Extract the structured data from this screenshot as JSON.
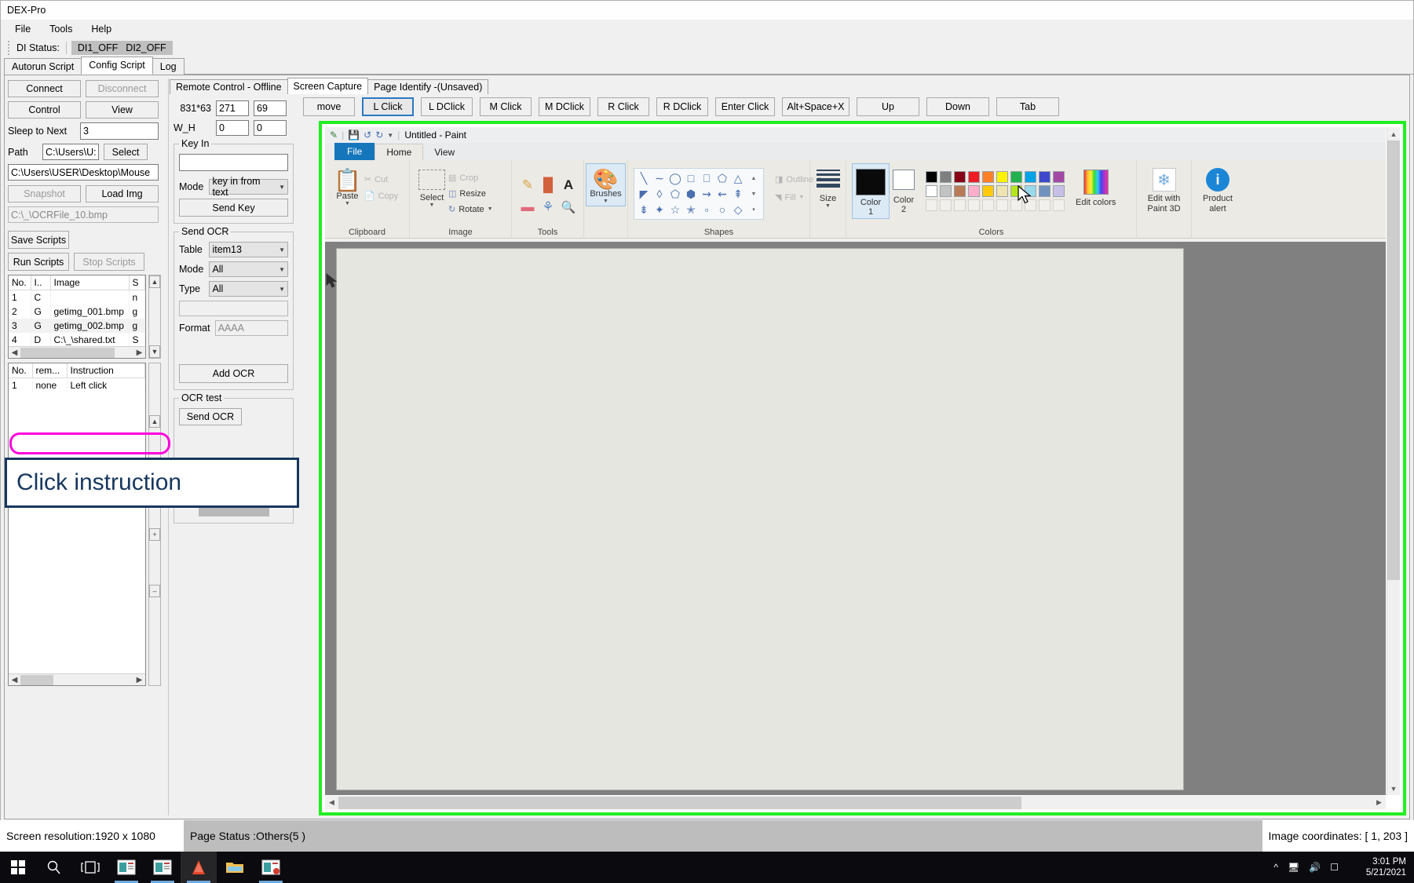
{
  "window": {
    "title": "DEX-Pro"
  },
  "menu": {
    "items": [
      "File",
      "Tools",
      "Help"
    ]
  },
  "di_status": {
    "label": "DI Status:",
    "di1": "DI1_OFF",
    "di2": "DI2_OFF"
  },
  "main_tabs": [
    {
      "label": "Autorun Script",
      "active": false
    },
    {
      "label": "Config Script",
      "active": true
    },
    {
      "label": "Log",
      "active": false
    }
  ],
  "left_panel": {
    "connect": "Connect",
    "disconnect": "Disconnect",
    "control": "Control",
    "view": "View",
    "sleep_label": "Sleep to Next",
    "sleep_value": "3",
    "path_label": "Path",
    "path_value": "C:\\Users\\U:",
    "select": "Select",
    "full_path": "C:\\Users\\USER\\Desktop\\Mouse",
    "snapshot": "Snapshot",
    "load_img": "Load Img",
    "ocr_file": "C:\\_\\OCRFile_10.bmp",
    "save_scripts": "Save Scripts",
    "run_scripts": "Run Scripts",
    "stop_scripts": "Stop Scripts",
    "script_table": {
      "headers": [
        "No.",
        "I..",
        "Image",
        "S"
      ],
      "rows": [
        [
          "1",
          "C",
          "",
          "n"
        ],
        [
          "2",
          "G",
          "getimg_001.bmp",
          "g"
        ],
        [
          "3",
          "G",
          "getimg_002.bmp",
          "g"
        ],
        [
          "4",
          "D",
          "C:\\_\\shared.txt",
          "S"
        ]
      ]
    },
    "instruction_table": {
      "headers": [
        "No.",
        "rem...",
        "Instruction"
      ],
      "rows": [
        [
          "1",
          "none",
          "Left click"
        ]
      ]
    }
  },
  "mid_panel": {
    "sub_tabs": [
      {
        "label": "Remote Control - Offline",
        "active": false
      },
      {
        "label": "Screen Capture",
        "active": true
      },
      {
        "label": "Page Identify -(Unsaved)",
        "active": false
      }
    ],
    "coord_label": "831*63",
    "coord_x": "271",
    "coord_y": "69",
    "wh_label": "W_H",
    "w_value": "0",
    "h_value": "0",
    "key_in": {
      "group": "Key In",
      "text_value": "",
      "mode_label": "Mode",
      "mode_value": "key in from text",
      "send_key": "Send Key"
    },
    "send_ocr": {
      "group": "Send OCR",
      "table_label": "Table",
      "table_value": "item13",
      "mode_label": "Mode",
      "mode_value": "All",
      "type_label": "Type",
      "type_value": "All",
      "extra_value": "",
      "format_label": "Format",
      "format_value": "AAAA",
      "add_ocr": "Add OCR"
    },
    "ocr_test": {
      "group": "OCR test",
      "send_ocr_btn": "Send OCR"
    }
  },
  "action_buttons": [
    {
      "label": "move",
      "state": "normal"
    },
    {
      "label": "L Click",
      "state": "focused"
    },
    {
      "label": "L DClick",
      "state": "normal"
    },
    {
      "label": "M Click",
      "state": "normal"
    },
    {
      "label": "M DClick",
      "state": "normal"
    },
    {
      "label": "R Click",
      "state": "normal"
    },
    {
      "label": "R DClick",
      "state": "normal"
    },
    {
      "label": "Enter Click",
      "state": "normal"
    },
    {
      "label": "Alt+Space+X",
      "state": "normal"
    },
    {
      "label": "Up",
      "state": "normal"
    },
    {
      "label": "Down",
      "state": "normal"
    },
    {
      "label": "Tab",
      "state": "normal"
    }
  ],
  "capture": {
    "border_color": "#22ee22",
    "paint": {
      "title": "Untitled - Paint",
      "ribbon_tabs": [
        "File",
        "Home",
        "View"
      ],
      "groups": [
        {
          "name": "Clipboard",
          "items": [
            "Paste",
            "Cut",
            "Copy"
          ]
        },
        {
          "name": "Image",
          "items": [
            "Select",
            "Crop",
            "Resize",
            "Rotate"
          ]
        },
        {
          "name": "Tools",
          "items": [
            "Pencil",
            "Fill with color",
            "Text",
            "Eraser",
            "Color picker",
            "Magnifier"
          ]
        },
        {
          "name": "Brushes",
          "items": [
            "Brushes"
          ]
        },
        {
          "name": "Shapes",
          "items": [
            "Outline",
            "Fill"
          ]
        },
        {
          "name": "Size",
          "items": [
            "Size"
          ]
        },
        {
          "name": "Colors",
          "items": [
            "Color 1",
            "Color 2",
            "Edit colors"
          ]
        },
        {
          "name": "",
          "items": [
            "Edit with Paint 3D",
            "Product alert"
          ]
        }
      ],
      "color1_label": "Color",
      "color1_num": "1",
      "color2_label": "Color",
      "color2_num": "2",
      "edit_colors": "Edit colors",
      "edit_paint3d": "Edit with Paint 3D",
      "product_alert": "Product alert",
      "palette_row1": [
        "#000000",
        "#7f7f7f",
        "#880015",
        "#ed1c24",
        "#ff7f27",
        "#fff200",
        "#22b14c",
        "#00a2e8",
        "#3f48cc",
        "#a349a4"
      ],
      "palette_row2": [
        "#ffffff",
        "#c3c3c3",
        "#b97a57",
        "#ffaec9",
        "#ffc90e",
        "#efe4b0",
        "#b5e61d",
        "#99d9ea",
        "#7092be",
        "#c8bfe7"
      ],
      "color1_value": "#000000",
      "color2_value": "#ffffff"
    }
  },
  "annotations": {
    "click_instruction": "Click instruction",
    "highlight_color": "#ff00dd",
    "box_color": "#17375e"
  },
  "status_bar": {
    "screen_resolution": "Screen resolution:1920 x 1080",
    "page_status": "Page Status :Others(5 )",
    "image_coordinates": "Image coordinates: [ 1, 203 ]"
  },
  "taskbar": {
    "clock_time": "3:01 PM",
    "clock_date": "5/21/2021",
    "icons": [
      "start-icon",
      "search-icon",
      "task-view-icon",
      "app1-icon",
      "app2-icon",
      "vlc-icon",
      "explorer-icon",
      "app3-icon"
    ]
  }
}
